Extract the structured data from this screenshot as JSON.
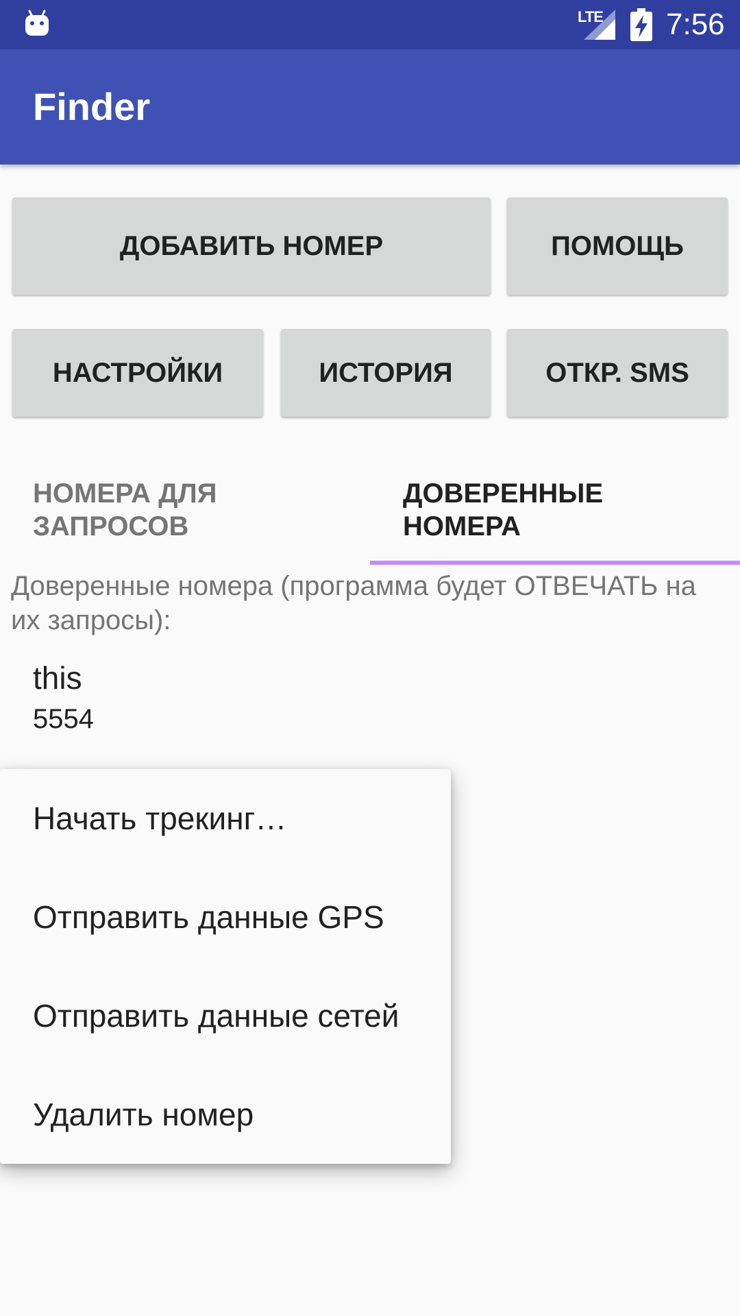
{
  "status_bar": {
    "network_type": "LTE",
    "time": "7:56",
    "icons": [
      "android-robot-icon",
      "signal-icon",
      "battery-charging-icon"
    ]
  },
  "app": {
    "title": "Finder"
  },
  "buttons": {
    "add_number": "ДОБАВИТЬ НОМЕР",
    "help": "ПОМОЩЬ",
    "settings": "НАСТРОЙКИ",
    "history": "ИСТОРИЯ",
    "open_sms": "ОТКР. SMS"
  },
  "tabs": [
    {
      "label": "НОМЕРА ДЛЯ ЗАПРОСОВ",
      "selected": false
    },
    {
      "label": "ДОВЕРЕННЫЕ НОМЕРА",
      "selected": true
    }
  ],
  "content": {
    "description": "Доверенные номера (программа будет ОТВЕЧАТЬ на их запросы):",
    "items": [
      {
        "name": "this",
        "number": "5554"
      }
    ]
  },
  "context_menu": {
    "items": [
      "Начать трекинг…",
      "Отправить данные GPS",
      "Отправить данные сетей",
      "Удалить номер"
    ]
  },
  "colors": {
    "status_bar": "#303f9f",
    "app_bar": "#3f51b5",
    "button": "#d6d7d7",
    "tab_indicator": "#c58af9",
    "background": "#fafafa"
  }
}
